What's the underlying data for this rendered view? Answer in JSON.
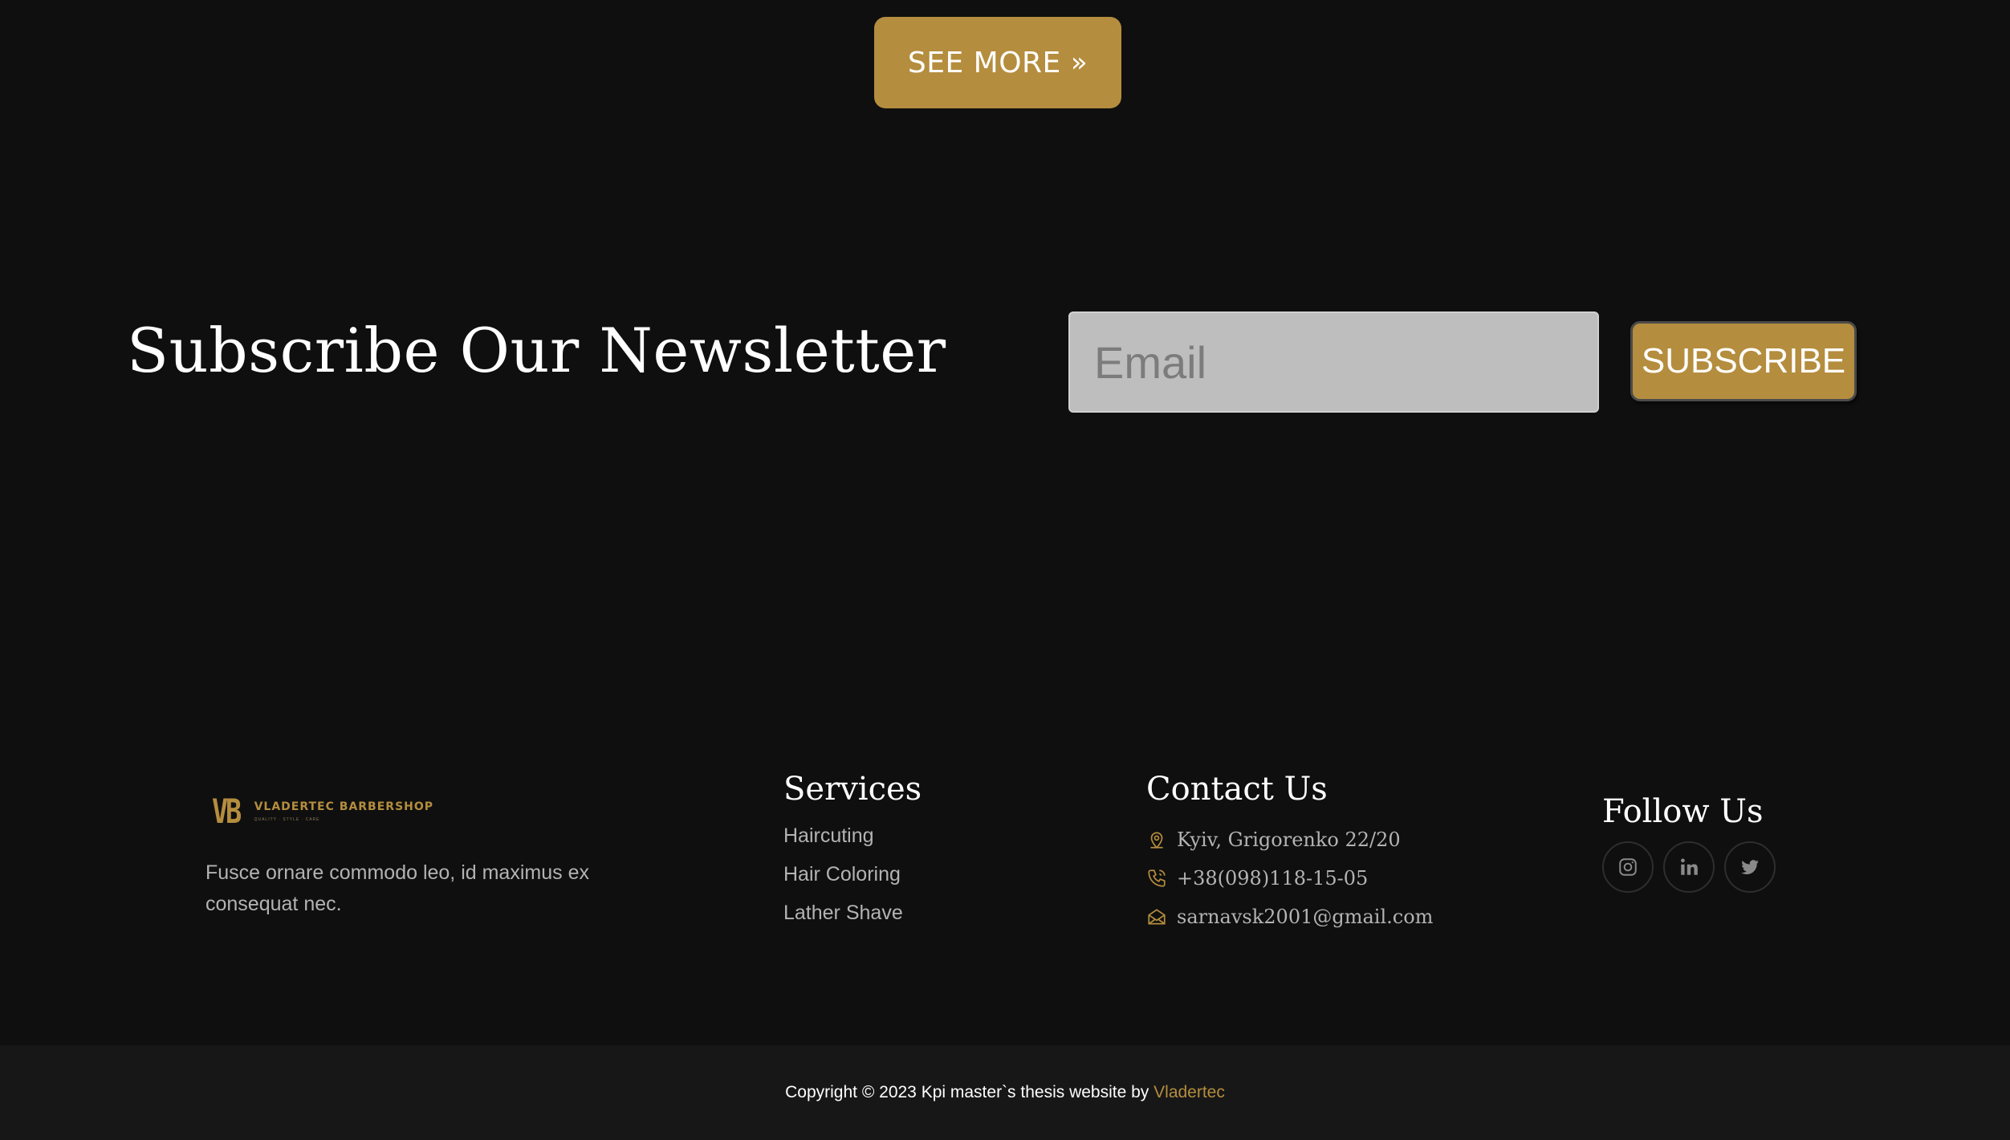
{
  "see_more": {
    "label": "SEE MORE",
    "icon": "double-chevron-right-icon"
  },
  "newsletter": {
    "title": "Subscribe Our Newsletter",
    "email_placeholder": "Email",
    "subscribe_label": "SUBSCRIBE"
  },
  "footer": {
    "logo": {
      "mark": "VB",
      "name": "VLADERTEC BARBERSHOP",
      "tagline": "QUALITY · STYLE · CARE"
    },
    "about": "Fusce ornare commodo leo, id maximus ex consequat nec.",
    "services": {
      "title": "Services",
      "items": [
        "Haircuting",
        "Hair Coloring",
        "Lather Shave"
      ]
    },
    "contact": {
      "title": "Contact Us",
      "address": "Kyiv, Grigorenko 22/20",
      "phone": "+38(098)118-15-05",
      "email": "sarnavsk2001@gmail.com"
    },
    "follow": {
      "title": "Follow Us",
      "socials": [
        "instagram-icon",
        "linkedin-icon",
        "twitter-icon"
      ]
    },
    "copyright_prefix": "Copyright © 2023 Kpi master`s thesis website by ",
    "copyright_link": "Vladertec"
  },
  "colors": {
    "accent": "#b48d3e",
    "background": "#0f0f0f",
    "footer_bar": "#171717"
  }
}
